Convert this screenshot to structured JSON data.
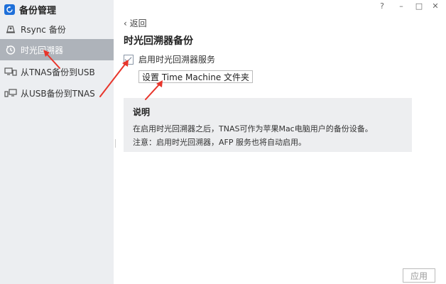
{
  "app": {
    "title": "备份管理"
  },
  "window_controls": {
    "help": "?",
    "minimize": "–",
    "maximize": "□",
    "close": "✕"
  },
  "sidebar": {
    "items": [
      {
        "label": "Rsync 备份",
        "icon": "rsync-icon",
        "active": false
      },
      {
        "label": "时光回溯器",
        "icon": "time-machine-icon",
        "active": true
      },
      {
        "label": "从TNAS备份到USB",
        "icon": "nas-to-usb-icon",
        "active": false
      },
      {
        "label": "从USB备份到TNAS",
        "icon": "usb-to-nas-icon",
        "active": false
      }
    ]
  },
  "main": {
    "back_label": "返回",
    "title": "时光回溯器备份",
    "enable_label": "启用时光回溯器服务",
    "enable_checked": true,
    "setup_button": "设置 Time Machine 文件夹",
    "info": {
      "heading": "说明",
      "line1": "在启用时光回溯器之后，TNAS可作为苹果Mac电脑用户的备份设备。",
      "line2": "注意：启用时光回溯器，AFP 服务也将自动启用。"
    },
    "apply_button": "应用"
  },
  "colors": {
    "accent": "#1e6fd9",
    "active_item": "#aeb3ba",
    "annotation_arrow": "#e8352b"
  }
}
